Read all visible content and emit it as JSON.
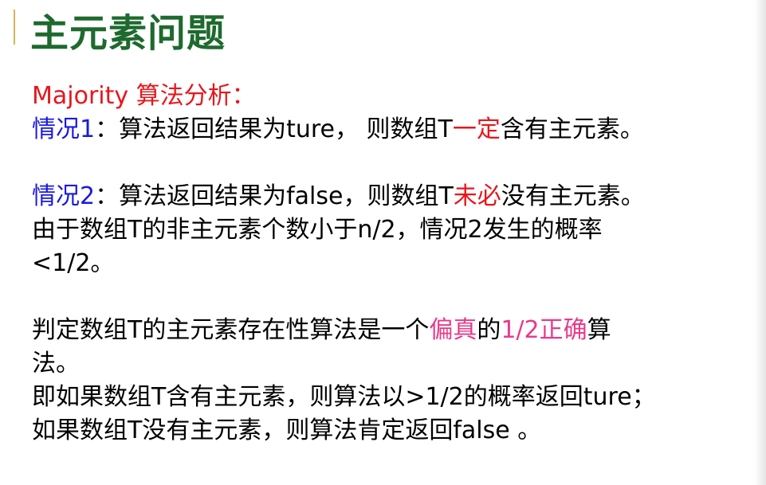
{
  "title": "主元素问题",
  "colors": {
    "title": "#1e6a2e",
    "red": "#e8161b",
    "blue": "#1a1adf",
    "pink": "#e83a8b"
  },
  "heading": "Majority 算法分析：",
  "case1": {
    "label": "情况1",
    "text_a": "：算法返回结果为ture， 则数组T",
    "emph": "一定",
    "text_b": "含有主元素。"
  },
  "case2": {
    "label": "情况2",
    "text_a": "：算法返回结果为false，则数组T",
    "emph": "未必",
    "text_b": "没有主元素。"
  },
  "reason_line1": "由于数组T的非主元素个数小于n/2，情况2发生的概率",
  "reason_line2": "<1/2。",
  "conclusion": {
    "part_a": "判定数组T的主元素存在性算法是一个",
    "emph1": "偏真",
    "part_b": "的",
    "emph2": "1/2正确",
    "part_c": "算",
    "line2": "法。"
  },
  "line_ture": "即如果数组T含有主元素，则算法以>1/2的概率返回ture；",
  "line_false": "如果数组T没有主元素，则算法肯定返回false 。"
}
